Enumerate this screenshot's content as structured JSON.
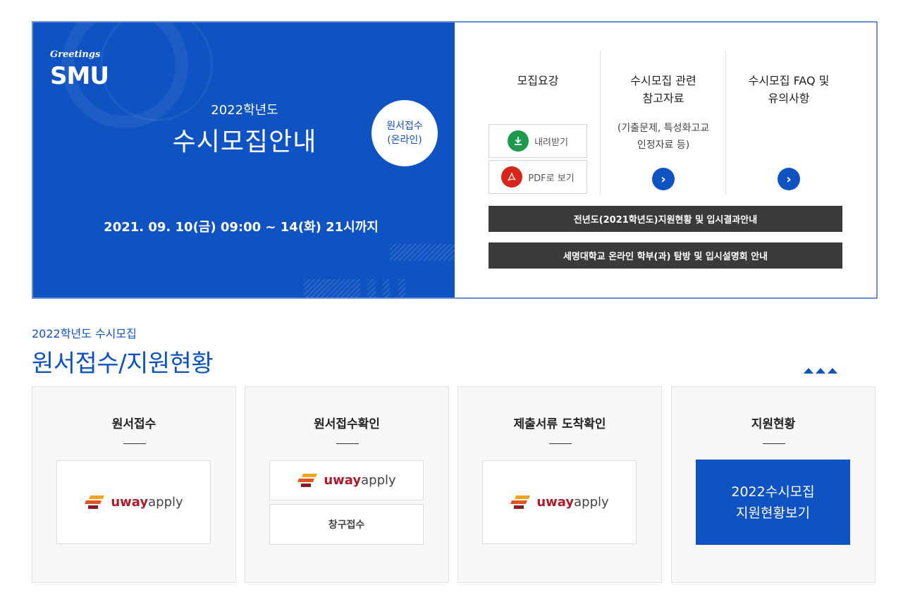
{
  "banner": {
    "greetings": "Greetings",
    "logo": "SMU",
    "year": "2022학년도",
    "title": "수시모집안내",
    "online_line1": "원서접수",
    "online_line2": "(온라인)",
    "period": "2021. 09. 10(금) 09:00 ~ 14(화) 21시까지"
  },
  "guide": {
    "title": "모집요강",
    "download_label": "내려받기",
    "pdf_label": "PDF로 보기"
  },
  "reference": {
    "title_line1": "수시모집 관련",
    "title_line2": "참고자료",
    "note_line1": "(기출문제, 특성화고교",
    "note_line2": "인정자료 등)"
  },
  "faq": {
    "title_line1": "수시모집 FAQ 및",
    "title_line2": "유의사항"
  },
  "bars": {
    "results": "전년도(2021학년도)지원현황 및 입시결과안내",
    "briefing": "세명대학교 온라인 학부(과) 탐방 및 입시설명회 안내"
  },
  "section": {
    "subtitle": "2022학년도 수시모집",
    "title": "원서접수/지원현황"
  },
  "cards": [
    {
      "title": "원서접수",
      "logo": {
        "part1": "uway",
        "part2": "apply"
      }
    },
    {
      "title": "원서접수확인",
      "logo": {
        "part1": "uway",
        "part2": "apply"
      },
      "window": "창구접수"
    },
    {
      "title": "제출서류 도착확인",
      "logo": {
        "part1": "uway",
        "part2": "apply"
      }
    },
    {
      "title": "지원현황",
      "button_line1": "2022수시모집",
      "button_line2": "지원현황보기"
    }
  ],
  "colors": {
    "brand_blue": "#0f52c2",
    "dark_bar": "#3a3a3a",
    "download_green": "#1e9a4c",
    "pdf_red": "#d9261c"
  },
  "icons": [
    "download-icon",
    "pdf-icon",
    "chevron-right-icon",
    "triangle-up-icon"
  ]
}
